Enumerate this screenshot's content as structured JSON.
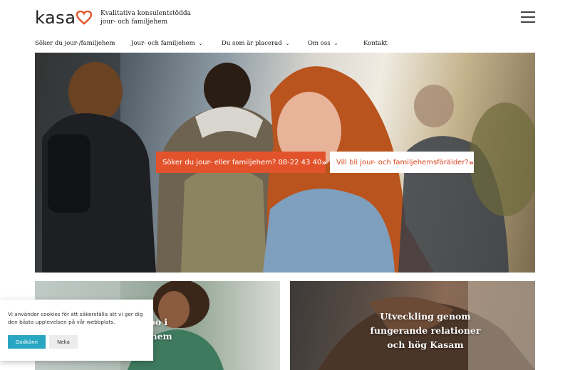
{
  "header": {
    "logo_text": "kasa",
    "tagline_line1": "Kvalitativa konsulentstödda",
    "tagline_line2": "jour- och familjehem",
    "menu_icon": "hamburger-menu-icon"
  },
  "nav": {
    "items": [
      {
        "label": "Söker du jour-/familjehem",
        "has_dropdown": false
      },
      {
        "label": "Jour- och familjehem",
        "has_dropdown": true
      },
      {
        "label": "Du som är placerad",
        "has_dropdown": true
      },
      {
        "label": "Om oss",
        "has_dropdown": true
      },
      {
        "label": "Kontakt",
        "has_dropdown": false
      }
    ],
    "chevron": "⌄"
  },
  "hero": {
    "primary_cta": "Söker du jour- eller familjehem? 08-22 43 40",
    "secondary_cta": "Vill bli jour- och familjehemsförälder?",
    "arrow": "»"
  },
  "cards": {
    "left_title_line1": "t bo i",
    "left_title_line2": "jehem",
    "right_title_line1": "Utveckling genom",
    "right_title_line2": "fungerande relationer",
    "right_title_line3": "och hög Kasam"
  },
  "cookie": {
    "text": "Vi använder cookies för att säkerställa att vi ger dig den bästa upplevelsen på vår webbplats.",
    "accept": "Godkänn",
    "decline": "Neka"
  },
  "colors": {
    "brand_orange": "#e2532c",
    "cookie_accent": "#2aa6c2"
  }
}
